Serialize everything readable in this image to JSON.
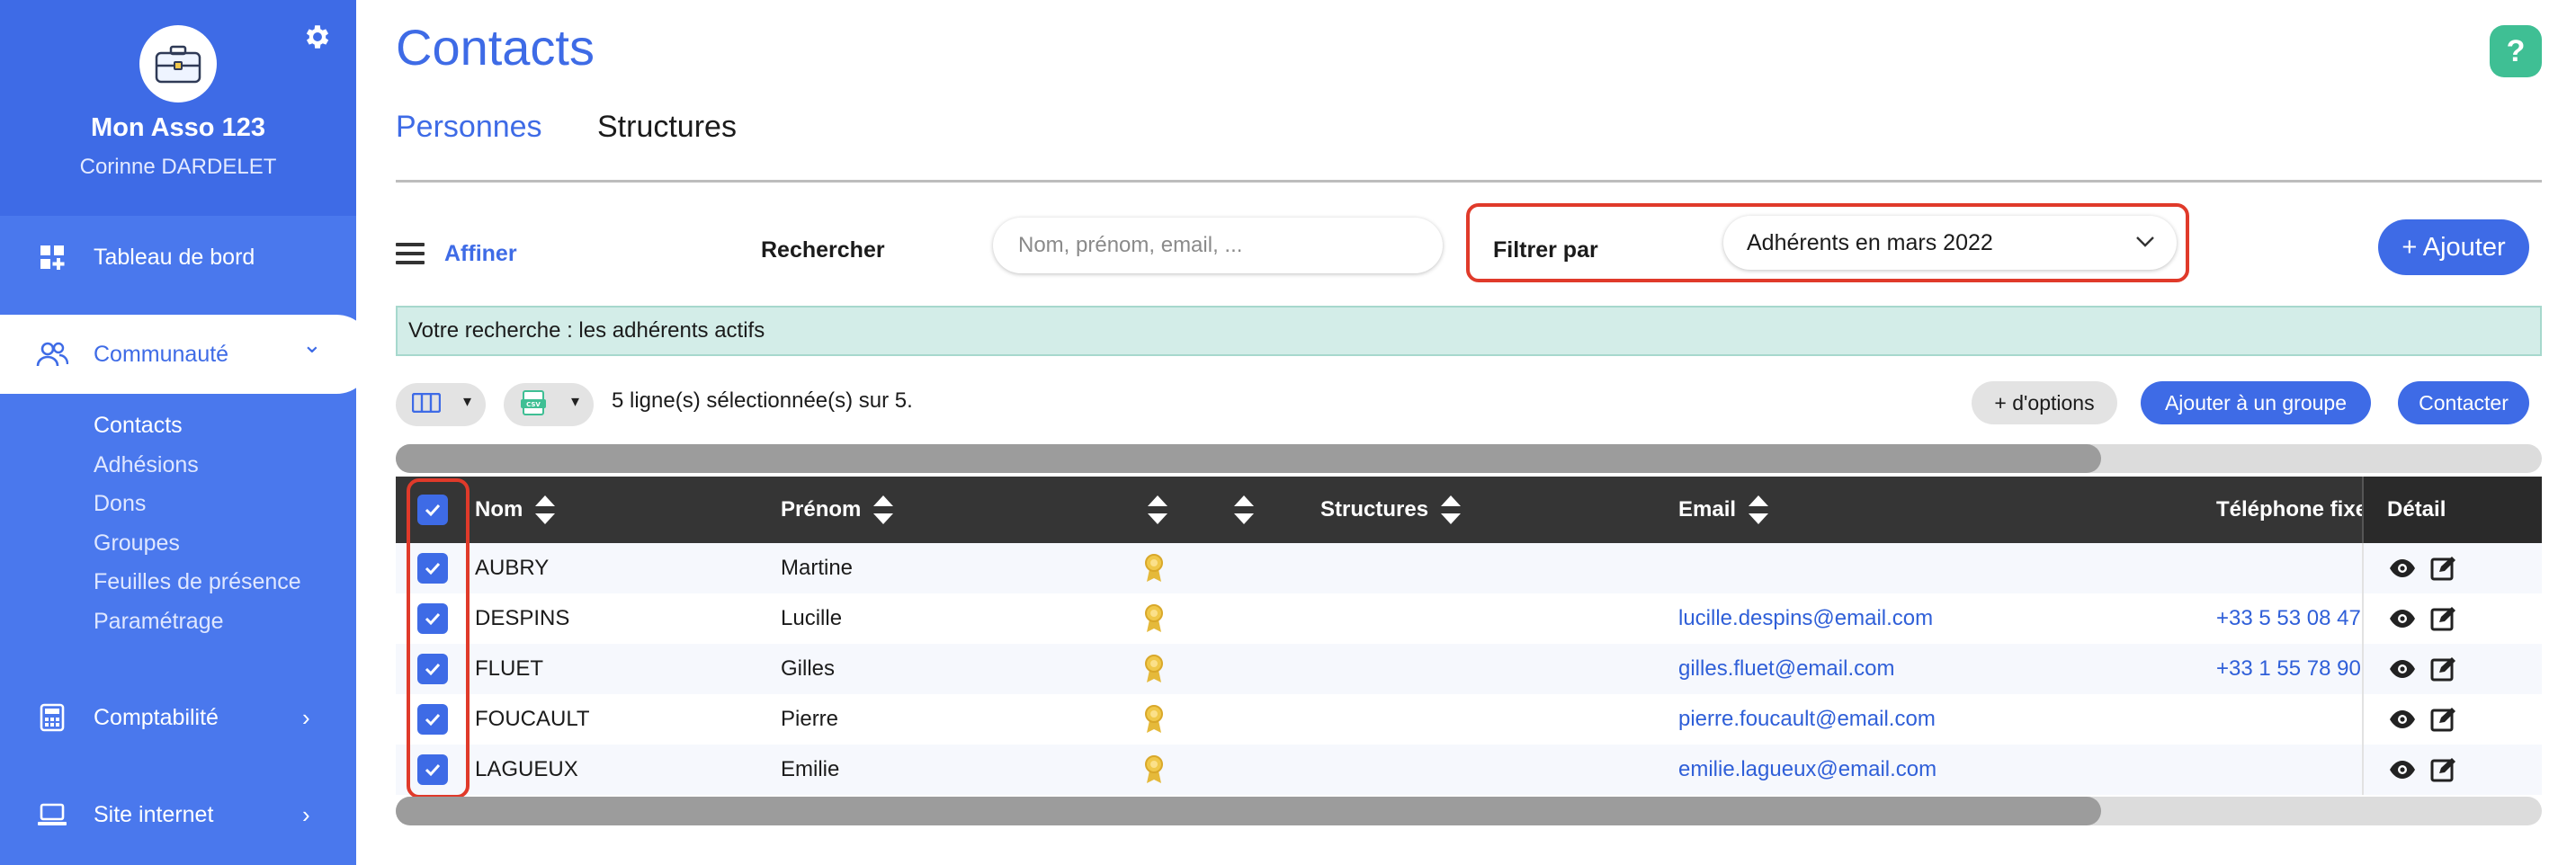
{
  "sidebar": {
    "org_name": "Mon Asso 123",
    "user_name": "Corinne DARDELET",
    "items": [
      {
        "label": "Tableau de bord",
        "icon": "dashboard-icon",
        "chevron": ""
      },
      {
        "label": "Communauté",
        "icon": "users-icon",
        "chevron": "⌄"
      },
      {
        "label": "Comptabilité",
        "icon": "calculator-icon",
        "chevron": "›"
      },
      {
        "label": "Site internet",
        "icon": "laptop-icon",
        "chevron": "›"
      }
    ],
    "subitems": [
      "Contacts",
      "Adhésions",
      "Dons",
      "Groupes",
      "Feuilles de présence",
      "Paramétrage"
    ]
  },
  "header": {
    "title": "Contacts",
    "help": "?",
    "tabs": [
      "Personnes",
      "Structures"
    ]
  },
  "toolbar": {
    "affiner_label": "Affiner",
    "search_label": "Rechercher",
    "search_placeholder": "Nom, prénom, email, ...",
    "filter_label": "Filtrer par",
    "filter_value": "Adhérents en mars 2022",
    "add_label": "+ Ajouter"
  },
  "recap": "Votre recherche : les adhérents actifs",
  "actions": {
    "selection_text": "5 ligne(s) sélectionnée(s) sur 5.",
    "options_label": "+ d'options",
    "group_label": "Ajouter à un groupe",
    "contact_label": "Contacter"
  },
  "table": {
    "headers": {
      "nom": "Nom",
      "prenom": "Prénom",
      "structures": "Structures",
      "email": "Email",
      "telephone": "Téléphone fixe",
      "detail": "Détail"
    },
    "rows": [
      {
        "nom": "AUBRY",
        "prenom": "Martine",
        "email": "",
        "telephone": ""
      },
      {
        "nom": "DESPINS",
        "prenom": "Lucille",
        "email": "lucille.despins@email.com",
        "telephone": "+33 5 53 08 47"
      },
      {
        "nom": "FLUET",
        "prenom": "Gilles",
        "email": "gilles.fluet@email.com",
        "telephone": "+33 1 55 78 90"
      },
      {
        "nom": "FOUCAULT",
        "prenom": "Pierre",
        "email": "pierre.foucault@email.com",
        "telephone": ""
      },
      {
        "nom": "LAGUEUX",
        "prenom": "Emilie",
        "email": "emilie.lagueux@email.com",
        "telephone": ""
      }
    ]
  },
  "colors": {
    "accent": "#3e6be6",
    "highlight_border": "#e03a2a",
    "recap_bg": "#d3ede8",
    "table_header": "#353535"
  }
}
